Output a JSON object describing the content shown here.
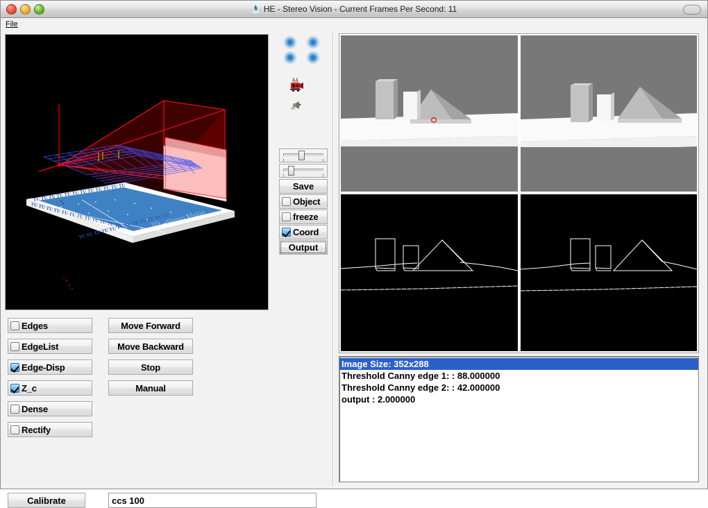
{
  "window": {
    "title": "HE - Stereo Vision - Current Frames Per Second: 11",
    "fps": "11",
    "traffic_lights": [
      "close",
      "minimize",
      "zoom"
    ],
    "toolbar_toggle": "toolbar-pill"
  },
  "menubar": {
    "items": [
      {
        "label": "File",
        "mnemonic": "F"
      }
    ]
  },
  "left_panel": {
    "view3d": {
      "name": "3d-scene-view",
      "background": "#000000",
      "elements": {
        "axes_color": "#ff0000",
        "grid_color": "#3a57ff",
        "frustum_color": "#b00000",
        "image_plane_color": "#ffb0b0",
        "logo_tile_color": "#3d7dc4",
        "marker_color": "#78b400",
        "logo_text": "TU"
      }
    },
    "checkboxes": [
      {
        "label": "Edges",
        "checked": false
      },
      {
        "label": "EdgeList",
        "checked": false
      },
      {
        "label": "Edge-Disp",
        "checked": true
      },
      {
        "label": "Z_c",
        "checked": true
      },
      {
        "label": "Dense",
        "checked": false
      },
      {
        "label": "Rectify",
        "checked": false
      }
    ],
    "buttons": [
      {
        "label": "Move Forward"
      },
      {
        "label": "Move Backward"
      },
      {
        "label": "Stop"
      },
      {
        "label": "Manual"
      }
    ],
    "calibrate_button": "Calibrate",
    "command_field": {
      "value": "ccs 100",
      "placeholder": ""
    }
  },
  "mid_panel": {
    "indicator_dots": [
      "dot-1",
      "dot-2",
      "dot-3",
      "dot-4"
    ],
    "icons": [
      {
        "name": "camcorder-icon"
      },
      {
        "name": "plug-icon"
      }
    ],
    "sliders": [
      {
        "name": "slider-1",
        "value_pct": 42
      },
      {
        "name": "slider-2",
        "value_pct": 19
      }
    ],
    "save_button": "Save",
    "checkboxes": [
      {
        "label": "Object",
        "checked": false
      },
      {
        "label": "freeze",
        "checked": false
      },
      {
        "label": "Coord",
        "checked": true
      }
    ],
    "output_button": {
      "label": "Output",
      "focused": true
    }
  },
  "right_panel": {
    "views": [
      {
        "name": "left-camera-view",
        "position": "top-left",
        "kind": "grayscale-scene"
      },
      {
        "name": "right-camera-view",
        "position": "top-right",
        "kind": "grayscale-scene"
      },
      {
        "name": "left-edge-view",
        "position": "bottom-left",
        "kind": "canny-edges"
      },
      {
        "name": "right-edge-view",
        "position": "bottom-right",
        "kind": "canny-edges"
      }
    ],
    "scene_objects": [
      "tall-gray-box",
      "small-white-box",
      "gray-pyramid",
      "ground-plane",
      "red-circle-marker"
    ],
    "log_list": [
      {
        "text": "Image Size: 352x288",
        "selected": true
      },
      {
        "text": "Threshold Canny edge 1:  : 88.000000",
        "selected": false
      },
      {
        "text": "Threshold Canny edge 2:  : 42.000000",
        "selected": false
      },
      {
        "text": "output : 2.000000",
        "selected": false
      }
    ]
  },
  "colors": {
    "selection_blue": "#2a60c8",
    "panel_gray": "#f2f2f2",
    "scene_bg_gray": "#787878",
    "edge_bg": "#000000"
  }
}
